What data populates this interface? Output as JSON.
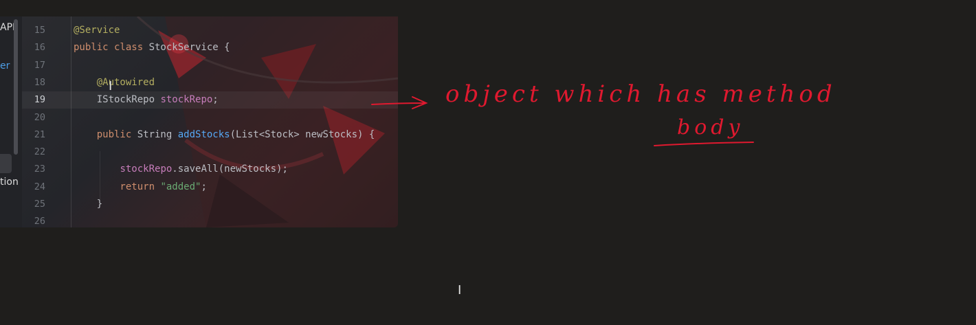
{
  "sidebar": {
    "text_top": "APP",
    "text_blue": "er",
    "text_bottom": "tion"
  },
  "code": {
    "lines": [
      {
        "n": "15",
        "parts": [
          {
            "t": "@Service",
            "c": "ann"
          }
        ]
      },
      {
        "n": "16",
        "parts": [
          {
            "t": "public class ",
            "c": "kw"
          },
          {
            "t": "StockService {",
            "c": ""
          }
        ]
      },
      {
        "n": "17",
        "parts": []
      },
      {
        "n": "18",
        "parts": [
          {
            "t": "    @Autowired",
            "c": "ann"
          }
        ]
      },
      {
        "n": "19",
        "parts": [
          {
            "t": "    IStockRepo ",
            "c": ""
          },
          {
            "t": "stockRepo",
            "c": "fld"
          },
          {
            "t": ";",
            "c": ""
          }
        ],
        "current": true
      },
      {
        "n": "20",
        "parts": []
      },
      {
        "n": "21",
        "parts": [
          {
            "t": "    public ",
            "c": "kw"
          },
          {
            "t": "String ",
            "c": ""
          },
          {
            "t": "addStocks",
            "c": "fn"
          },
          {
            "t": "(List<Stock> newStocks) {",
            "c": ""
          }
        ]
      },
      {
        "n": "22",
        "parts": []
      },
      {
        "n": "23",
        "parts": [
          {
            "t": "        ",
            "c": ""
          },
          {
            "t": "stockRepo",
            "c": "fld"
          },
          {
            "t": ".saveAll(newStocks);",
            "c": ""
          }
        ]
      },
      {
        "n": "24",
        "parts": [
          {
            "t": "        return ",
            "c": "kw"
          },
          {
            "t": "\"added\"",
            "c": "str"
          },
          {
            "t": ";",
            "c": ""
          }
        ]
      },
      {
        "n": "25",
        "parts": [
          {
            "t": "    }",
            "c": ""
          }
        ]
      },
      {
        "n": "26",
        "parts": []
      }
    ]
  },
  "annotation": {
    "line1": "object  which  has  method",
    "line2": "body"
  },
  "colors": {
    "ink": "#e0192f",
    "background": "#1f1e1c"
  },
  "icons": {
    "cursor": "text-cursor-icon"
  }
}
